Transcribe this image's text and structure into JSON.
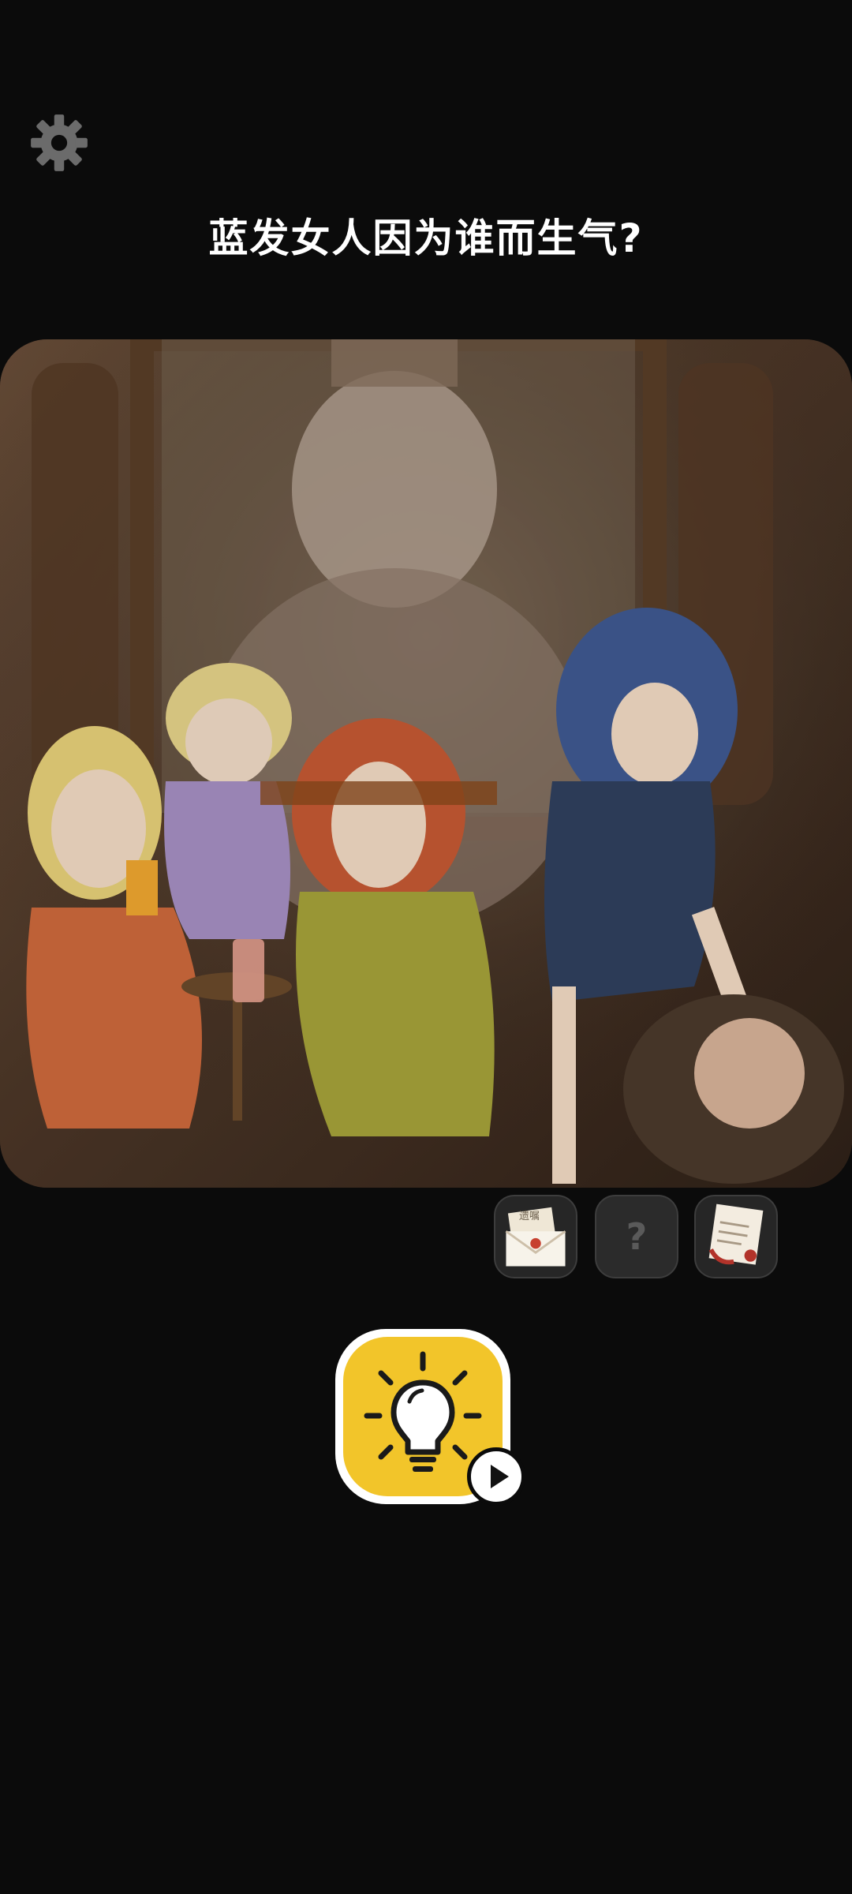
{
  "header": {
    "settings_icon": "gear-icon"
  },
  "question": {
    "text": "蓝发女人因为谁而生气?"
  },
  "scene": {
    "description_icon": "game-scene-illustration"
  },
  "inventory": {
    "slots": [
      {
        "icon": "letter-envelope-icon",
        "label": "遗嘱"
      },
      {
        "icon": "unknown-item-icon",
        "label": "?"
      },
      {
        "icon": "scroll-document-icon",
        "label": ""
      }
    ]
  },
  "hint": {
    "icon": "lightbulb-icon",
    "badge_icon": "video-play-icon"
  },
  "colors": {
    "background": "#0b0b0b",
    "hint_yellow": "#f2c52a",
    "slot_bg": "#262626",
    "settings_gray": "#6b6b6b"
  }
}
